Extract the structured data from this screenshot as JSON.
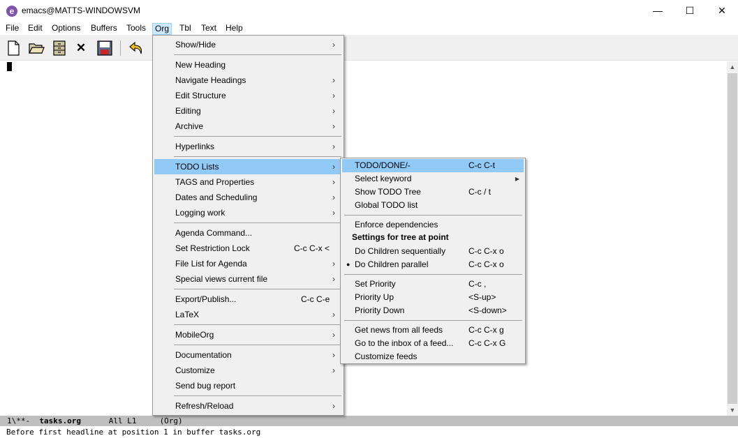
{
  "window": {
    "title": "emacs@MATTS-WINDOWSVM",
    "icon": "emacs-icon",
    "minimize": "—",
    "maximize": "☐",
    "close": "✕"
  },
  "menubar": [
    "File",
    "Edit",
    "Options",
    "Buffers",
    "Tools",
    "Org",
    "Tbl",
    "Text",
    "Help"
  ],
  "toolbar": {
    "icons": [
      "new-file-icon",
      "open-folder-icon",
      "dired-cabinet-icon",
      "close-buffer-icon",
      "save-icon",
      "undo-icon"
    ],
    "close_glyph": "✕"
  },
  "org_menu": {
    "items": [
      {
        "label": "Show/Hide",
        "arrow": "›"
      },
      {
        "label": "New Heading"
      },
      {
        "label": "Navigate Headings",
        "arrow": "›"
      },
      {
        "label": "Edit Structure",
        "arrow": "›"
      },
      {
        "label": "Editing",
        "arrow": "›"
      },
      {
        "label": "Archive",
        "arrow": "›"
      },
      {
        "label": "Hyperlinks",
        "arrow": "›"
      },
      {
        "label": "TODO Lists",
        "arrow": "›"
      },
      {
        "label": "TAGS and Properties",
        "arrow": "›"
      },
      {
        "label": "Dates and Scheduling",
        "arrow": "›"
      },
      {
        "label": "Logging work",
        "arrow": "›"
      },
      {
        "label": "Agenda Command..."
      },
      {
        "label": "Set Restriction Lock",
        "shortcut": "C-c C-x <"
      },
      {
        "label": "File List for Agenda",
        "arrow": "›"
      },
      {
        "label": "Special views current file",
        "arrow": "›"
      },
      {
        "label": "Export/Publish...",
        "shortcut": "C-c C-e"
      },
      {
        "label": "LaTeX",
        "arrow": "›"
      },
      {
        "label": "MobileOrg",
        "arrow": "›"
      },
      {
        "label": "Documentation",
        "arrow": "›"
      },
      {
        "label": "Customize",
        "arrow": "›"
      },
      {
        "label": "Send bug report"
      },
      {
        "label": "Refresh/Reload",
        "arrow": "›"
      }
    ]
  },
  "todo_submenu": {
    "items": [
      {
        "label": "TODO/DONE/-",
        "shortcut": "C-c C-t"
      },
      {
        "label": "Select keyword",
        "arrow": "▶"
      },
      {
        "label": "Show TODO Tree",
        "shortcut": "C-c / t"
      },
      {
        "label": "Global TODO list"
      },
      {
        "label": "Enforce dependencies"
      },
      {
        "label": "Settings for tree at point"
      },
      {
        "label": "Do Children sequentially",
        "shortcut": "C-c C-x o"
      },
      {
        "label": "Do Children parallel",
        "shortcut": "C-c C-x o",
        "bullet": "●"
      },
      {
        "label": "Set Priority",
        "shortcut": "C-c ,"
      },
      {
        "label": "Priority Up",
        "shortcut": "<S-up>"
      },
      {
        "label": "Priority Down",
        "shortcut": "<S-down>"
      },
      {
        "label": "Get news from all feeds",
        "shortcut": "C-c C-x g"
      },
      {
        "label": "Go to the inbox of a feed...",
        "shortcut": "C-c C-x G"
      },
      {
        "label": "Customize feeds"
      }
    ]
  },
  "scrollbar": {
    "up": "▲",
    "down": "▼"
  },
  "modeline": {
    "prefix": "1\\**-  ",
    "buffer": "tasks.org",
    "position": "      All L1     ",
    "mode": "(Org)"
  },
  "echo": "Before first headline at position 1 in buffer tasks.org",
  "colors": {
    "menu_highlight": "#91c9f7",
    "menubar_active": "#cce8ff",
    "modeline": "#bfbfbf"
  }
}
